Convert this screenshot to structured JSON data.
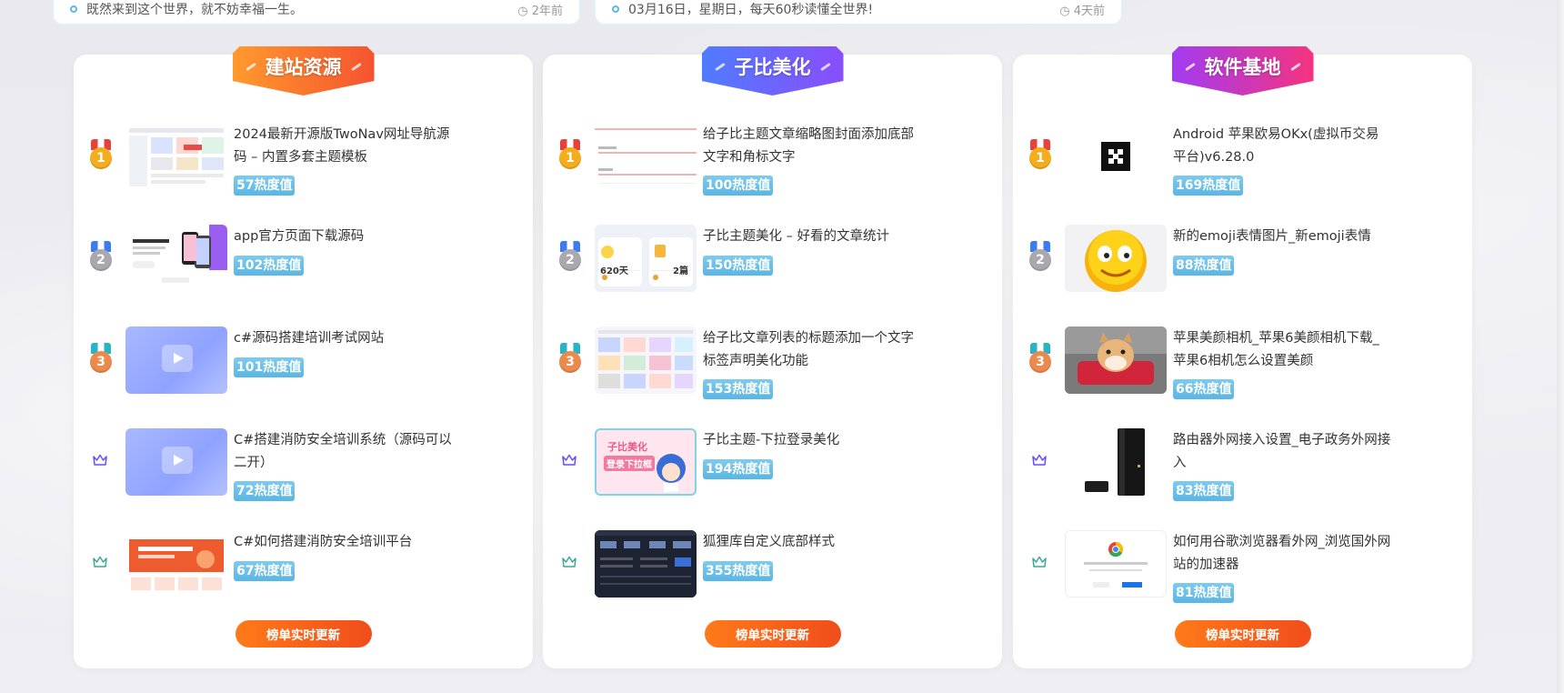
{
  "notices": [
    {
      "text": "既然来到这个世界，就不妨幸福一生。",
      "time": "2年前"
    },
    {
      "text": "03月16日，星期日，每天60秒读懂全世界!",
      "time": "4天前"
    }
  ],
  "panels": [
    {
      "title": "建站资源",
      "button_label": "榜单实时更新",
      "items": [
        {
          "rank": "1",
          "title": "2024最新开源版TwoNav网址导航源码 – 内置多套主题模板",
          "heat": "57热度值"
        },
        {
          "rank": "2",
          "title": "app官方页面下载源码",
          "heat": "102热度值"
        },
        {
          "rank": "3",
          "title": "c#源码搭建培训考试网站",
          "heat": "101热度值"
        },
        {
          "rank": "",
          "title": "C#搭建消防安全培训系统（源码可以二开）",
          "heat": "72热度值"
        },
        {
          "rank": "",
          "title": "C#如何搭建消防安全培训平台",
          "heat": "67热度值"
        }
      ]
    },
    {
      "title": "子比美化",
      "button_label": "榜单实时更新",
      "items": [
        {
          "rank": "1",
          "title": "给子比主题文章缩略图封面添加底部文字和角标文字",
          "heat": "100热度值"
        },
        {
          "rank": "2",
          "title": "子比主题美化 – 好看的文章统计",
          "heat": "150热度值"
        },
        {
          "rank": "3",
          "title": "给子比文章列表的标题添加一个文字标签声明美化功能",
          "heat": "153热度值"
        },
        {
          "rank": "",
          "title": "子比主题-下拉登录美化",
          "heat": "194热度值"
        },
        {
          "rank": "",
          "title": "狐狸库自定义底部样式",
          "heat": "355热度值"
        }
      ]
    },
    {
      "title": "软件基地",
      "button_label": "榜单实时更新",
      "items": [
        {
          "rank": "1",
          "title": "Android 苹果欧易OKx(虚拟币交易平台)v6.28.0",
          "heat": "169热度值"
        },
        {
          "rank": "2",
          "title": "新的emoji表情图片_新emoji表情",
          "heat": "88热度值"
        },
        {
          "rank": "3",
          "title": "苹果美颜相机_苹果6美颜相机下载_苹果6相机怎么设置美颜",
          "heat": "66热度值"
        },
        {
          "rank": "",
          "title": "路由器外网接入设置_电子政务外网接入",
          "heat": "83热度值"
        },
        {
          "rank": "",
          "title": "如何用谷歌浏览器看外网_浏览国外网站的加速器",
          "heat": "81热度值"
        }
      ]
    }
  ],
  "thumb_text": {
    "stat_days": "620天",
    "stat_count": "2篇",
    "zibi_line1": "子比美化",
    "zibi_line2": "登录下拉框"
  },
  "colors": {
    "heat_badge": "#5ab8e6",
    "button_start": "#ff7a1a",
    "button_end": "#f04d1b",
    "ribbon_orange": "#f5532f",
    "ribbon_blue": "#4f7cff",
    "ribbon_purple": "#a23cf2"
  },
  "icons": {
    "rank_medal": "medal-icon",
    "rank_other": "crown-icon",
    "notice_dot": "circle-icon",
    "time": "clock-icon"
  }
}
